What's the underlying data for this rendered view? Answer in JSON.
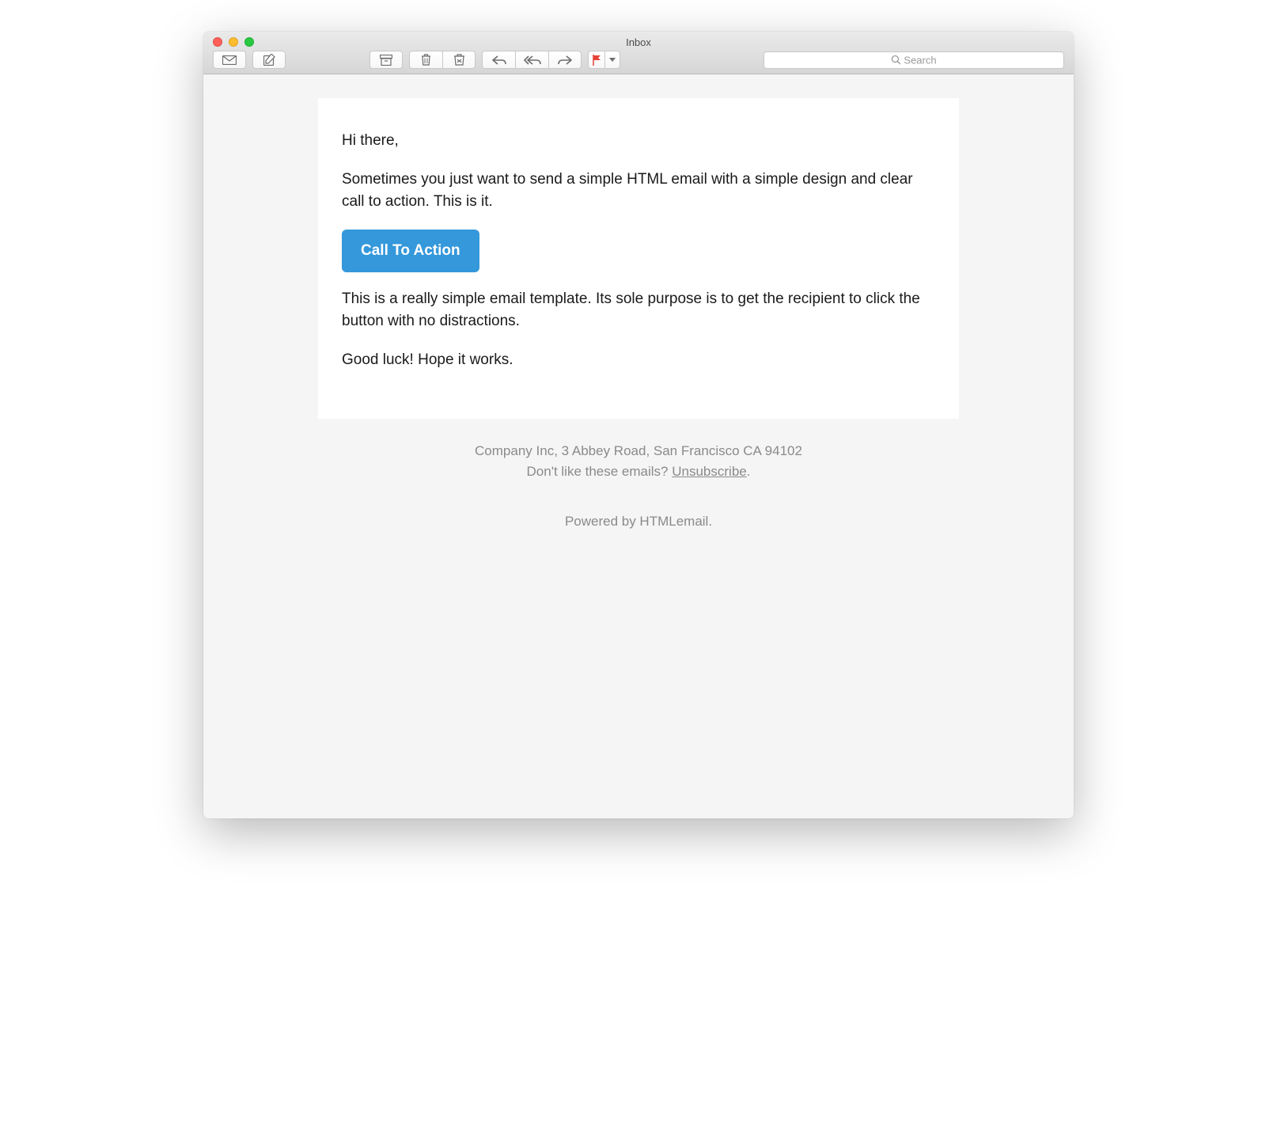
{
  "window": {
    "title": "Inbox"
  },
  "toolbar": {
    "icons": {
      "mailbox": "mailbox",
      "compose": "compose",
      "archive": "archive",
      "delete": "delete",
      "junk": "junk",
      "reply": "reply",
      "reply_all": "reply-all",
      "forward": "forward",
      "flag": "flag",
      "dropdown": "chevron-down"
    },
    "search_placeholder": "Search"
  },
  "email": {
    "greeting": "Hi there,",
    "intro": "Sometimes you just want to send a simple HTML email with a simple design and clear call to action. This is it.",
    "cta_label": "Call To Action",
    "blurb": "This is a really simple email template. Its sole purpose is to get the recipient to click the button with no distractions.",
    "signoff": "Good luck! Hope it works."
  },
  "footer": {
    "company_line": "Company Inc, 3 Abbey Road, San Francisco CA 94102",
    "dislike_prefix": "Don't like these emails? ",
    "unsubscribe": "Unsubscribe",
    "period": ".",
    "powered_by": "Powered by HTMLemail."
  },
  "colors": {
    "cta": "#3498db",
    "body_bg": "#f5f5f5"
  }
}
